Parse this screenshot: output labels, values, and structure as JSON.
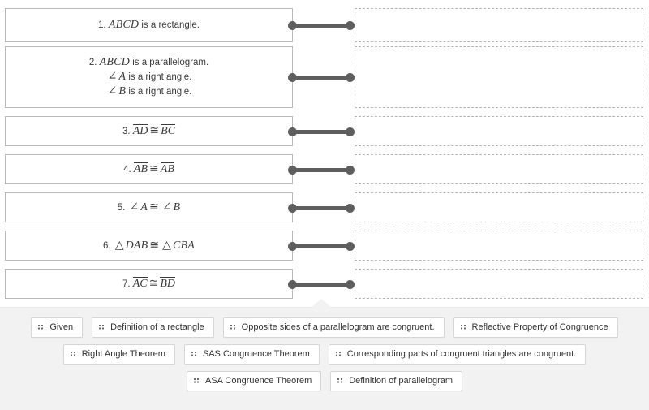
{
  "proof": {
    "rows": [
      {
        "number": "1.",
        "lines": [
          "ABCD is a rectangle."
        ],
        "statement_plain": "1. ABCD is a rectangle.",
        "reason_value": "",
        "reason_placeholder": "",
        "connector": "link-connector"
      },
      {
        "number": "2.",
        "lines": [
          "ABCD is a parallelogram.",
          "∠A is a right angle.",
          "∠B is a right angle."
        ],
        "statement_plain": "2. ABCD is a parallelogram. ∠A is a right angle. ∠B is a right angle.",
        "reason_value": "",
        "reason_placeholder": "",
        "connector": "link-connector"
      },
      {
        "number": "3.",
        "lines": [
          "AD ≅ BC"
        ],
        "statement_plain": "3. AD ≅ BC",
        "reason_value": "",
        "reason_placeholder": "",
        "connector": "link-connector"
      },
      {
        "number": "4.",
        "lines": [
          "AB ≅ AB"
        ],
        "statement_plain": "4. AB ≅ AB",
        "reason_value": "",
        "reason_placeholder": "",
        "connector": "link-connector"
      },
      {
        "number": "5.",
        "lines": [
          "∠A ≅ ∠B"
        ],
        "statement_plain": "5. ∠A ≅ ∠B",
        "reason_value": "",
        "reason_placeholder": "",
        "connector": "link-connector"
      },
      {
        "number": "6.",
        "lines": [
          "△DAB ≅ △CBA"
        ],
        "statement_plain": "6. △DAB ≅ △CBA",
        "reason_value": "",
        "reason_placeholder": "",
        "connector": "link-connector"
      },
      {
        "number": "7.",
        "lines": [
          "AC ≅ BD"
        ],
        "statement_plain": "7. AC ≅ BD",
        "reason_value": "",
        "reason_placeholder": "",
        "connector": "link-connector"
      }
    ]
  },
  "answer_bank": {
    "drag_handle_icon": "drag-handle-icon",
    "rows": [
      [
        {
          "label": "Given"
        },
        {
          "label": "Definition of a rectangle"
        },
        {
          "label": "Opposite sides of a parallelogram are congruent."
        },
        {
          "label": "Reflective Property of Congruence"
        }
      ],
      [
        {
          "label": "Right Angle Theorem"
        },
        {
          "label": "SAS Congruence Theorem"
        },
        {
          "label": "Corresponding parts of congruent triangles are congruent."
        }
      ],
      [
        {
          "label": "ASA Congruence Theorem"
        },
        {
          "label": "Definition of parallelogram"
        }
      ]
    ]
  },
  "colors": {
    "panel_background": "#f2f2f2",
    "statement_border": "#b9b9b9",
    "drop_border": "#b5b5b5",
    "connector": "#5e5e5e",
    "chip_border": "#d6d6d6",
    "text": "#3c3c3c"
  }
}
